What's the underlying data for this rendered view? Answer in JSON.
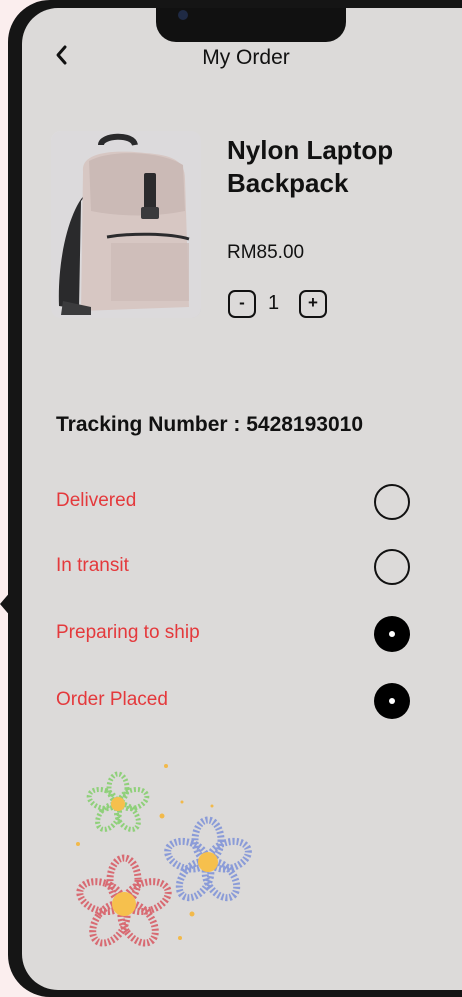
{
  "header": {
    "title": "My Order",
    "back_icon": "chevron-left-icon"
  },
  "product": {
    "name": "Nylon Laptop Backpack",
    "price": "RM85.00",
    "quantity": "1",
    "minus_label": "-",
    "plus_label": "+"
  },
  "tracking": {
    "text": "Tracking Number : 5428193010"
  },
  "statuses": [
    {
      "label": "Delivered",
      "completed": false
    },
    {
      "label": "In transit",
      "completed": false
    },
    {
      "label": "Preparing to ship",
      "completed": true
    },
    {
      "label": "Order Placed",
      "completed": true
    }
  ],
  "colors": {
    "background": "#dcdad9",
    "status_text": "#e4393c",
    "frame": "#151515",
    "flower_green": "#8fd07a",
    "flower_blue": "#8a9bd8",
    "flower_red": "#d86a72",
    "flower_center": "#f6c04d"
  }
}
